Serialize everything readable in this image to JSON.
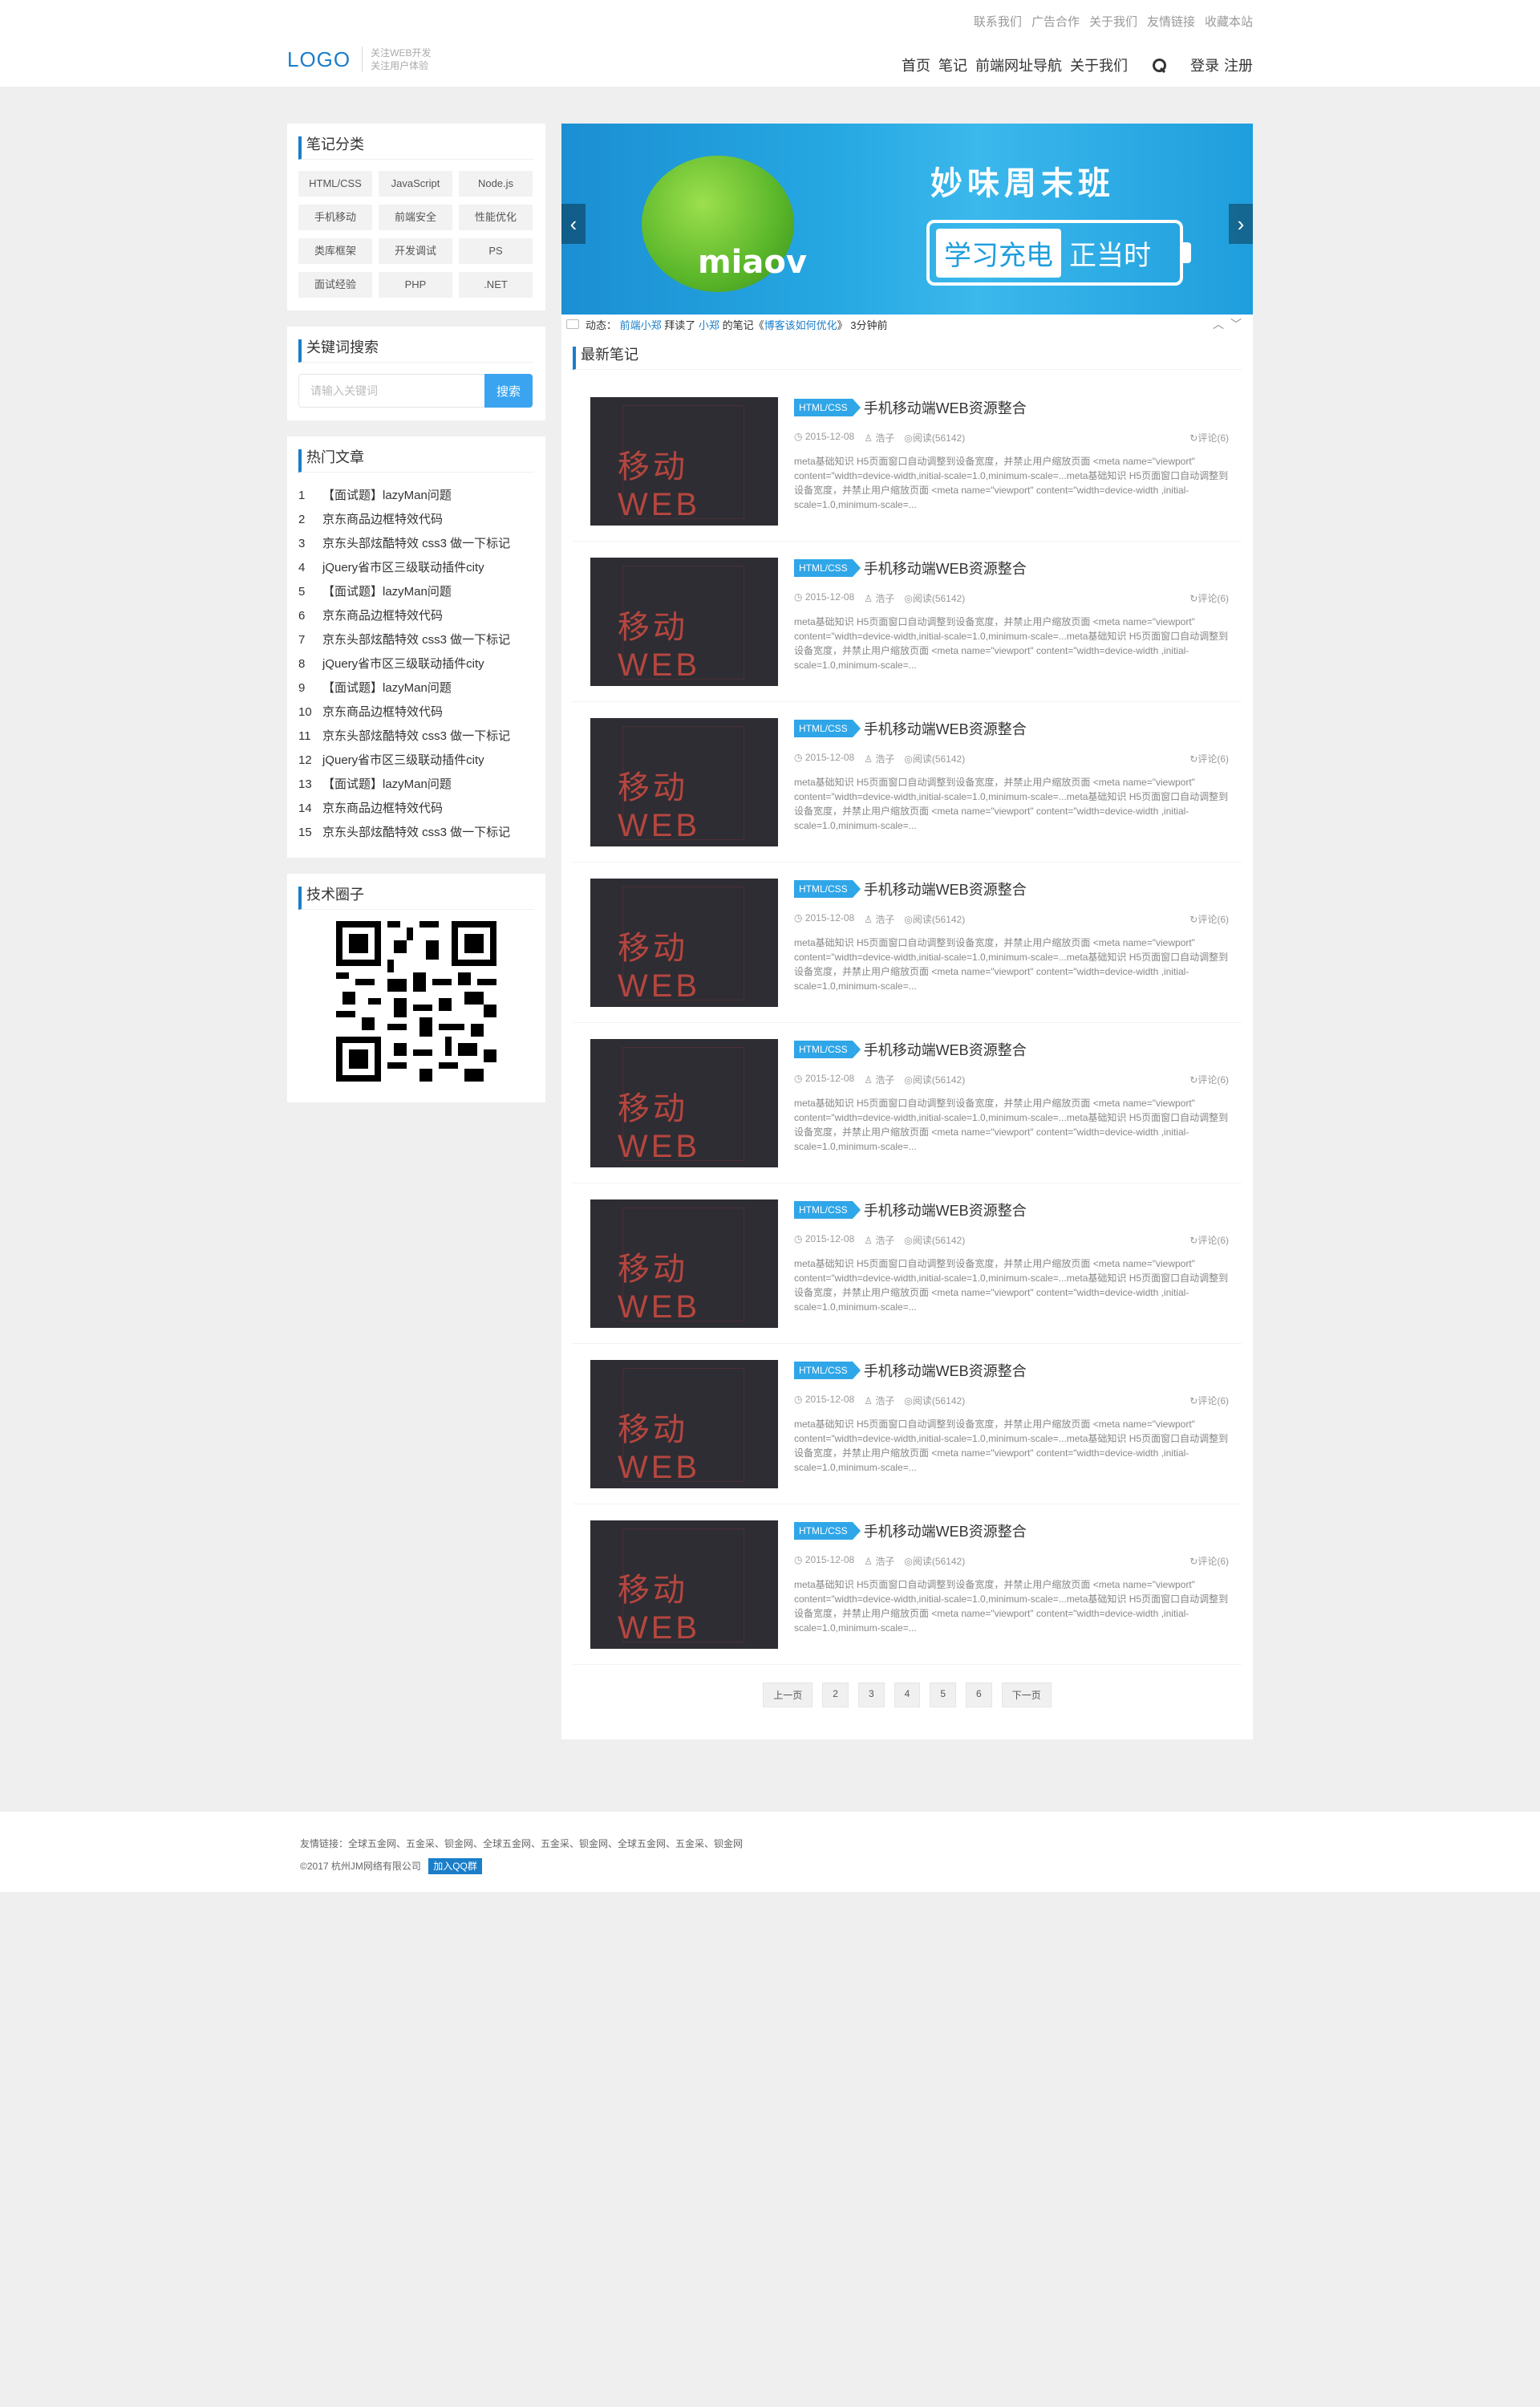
{
  "header": {
    "top_links": [
      "联系我们",
      "广告合作",
      "关于我们",
      "友情链接",
      "收藏本站"
    ],
    "logo": "LOGO",
    "slogan": [
      "关注WEB开发",
      "关注用户体验"
    ],
    "nav": [
      "首页",
      "笔记",
      "前端网址导航",
      "关于我们"
    ],
    "login": "登录",
    "register": "注册"
  },
  "sidebar": {
    "categories_title": "笔记分类",
    "categories": [
      "HTML/CSS",
      "JavaScript",
      "Node.js",
      "手机移动",
      "前端安全",
      "性能优化",
      "类库框架",
      "开发调试",
      "PS",
      "面试经验",
      "PHP",
      ".NET"
    ],
    "search_title": "关键词搜索",
    "search_placeholder": "请输入关键词",
    "search_button": "搜索",
    "hot_title": "热门文章",
    "hot_articles": [
      "【面试题】lazyMan问题",
      "京东商品边框特效代码",
      "京东头部炫酷特效 css3 做一下标记",
      "jQuery省市区三级联动插件city",
      "【面试题】lazyMan问题",
      "京东商品边框特效代码",
      "京东头部炫酷特效 css3 做一下标记",
      "jQuery省市区三级联动插件city",
      "【面试题】lazyMan问题",
      "京东商品边框特效代码",
      "京东头部炫酷特效 css3 做一下标记",
      "jQuery省市区三级联动插件city",
      "【面试题】lazyMan问题",
      "京东商品边框特效代码",
      "京东头部炫酷特效 css3 做一下标记"
    ],
    "circle_title": "技术圈子"
  },
  "banner": {
    "brand": "miaov",
    "title": "妙味周末班",
    "battery_highlight": "学习充电",
    "battery_text": "正当时",
    "prev": "‹",
    "next": "›"
  },
  "ticker": {
    "label": "动态：",
    "user": "前端小郑",
    "action": "拜读了",
    "author": "小郑",
    "mid": "的笔记《",
    "note": "博客该如何优化",
    "end": "》",
    "time": "3分钟前",
    "up": "︿",
    "down": "﹀"
  },
  "notes_section": {
    "title": "最新笔记",
    "thumb_text": "移动 WEB",
    "items": [
      {
        "tag": "HTML/CSS",
        "title": "手机移动端WEB资源整合",
        "date": "2015-12-08",
        "author": "浩子",
        "views": "阅读(56142)",
        "comments": "评论(6)",
        "excerpt": "meta基础知识 H5页面窗口自动调整到设备宽度，并禁止用户缩放页面 <meta name=\"viewport\" content=\"width=device-width,initial-scale=1.0,minimum-scale=...meta基础知识 H5页面窗口自动调整到设备宽度，并禁止用户缩放页面 <meta name=\"viewport\" content=\"width=device-width ,initial-scale=1.0,minimum-scale=..."
      },
      {
        "tag": "HTML/CSS",
        "title": "手机移动端WEB资源整合",
        "date": "2015-12-08",
        "author": "浩子",
        "views": "阅读(56142)",
        "comments": "评论(6)",
        "excerpt": "meta基础知识 H5页面窗口自动调整到设备宽度，并禁止用户缩放页面 <meta name=\"viewport\" content=\"width=device-width,initial-scale=1.0,minimum-scale=...meta基础知识 H5页面窗口自动调整到设备宽度，并禁止用户缩放页面 <meta name=\"viewport\" content=\"width=device-width ,initial-scale=1.0,minimum-scale=..."
      },
      {
        "tag": "HTML/CSS",
        "title": "手机移动端WEB资源整合",
        "date": "2015-12-08",
        "author": "浩子",
        "views": "阅读(56142)",
        "comments": "评论(6)",
        "excerpt": "meta基础知识 H5页面窗口自动调整到设备宽度，并禁止用户缩放页面 <meta name=\"viewport\" content=\"width=device-width,initial-scale=1.0,minimum-scale=...meta基础知识 H5页面窗口自动调整到设备宽度，并禁止用户缩放页面 <meta name=\"viewport\" content=\"width=device-width ,initial-scale=1.0,minimum-scale=..."
      },
      {
        "tag": "HTML/CSS",
        "title": "手机移动端WEB资源整合",
        "date": "2015-12-08",
        "author": "浩子",
        "views": "阅读(56142)",
        "comments": "评论(6)",
        "excerpt": "meta基础知识 H5页面窗口自动调整到设备宽度，并禁止用户缩放页面 <meta name=\"viewport\" content=\"width=device-width,initial-scale=1.0,minimum-scale=...meta基础知识 H5页面窗口自动调整到设备宽度，并禁止用户缩放页面 <meta name=\"viewport\" content=\"width=device-width ,initial-scale=1.0,minimum-scale=..."
      },
      {
        "tag": "HTML/CSS",
        "title": "手机移动端WEB资源整合",
        "date": "2015-12-08",
        "author": "浩子",
        "views": "阅读(56142)",
        "comments": "评论(6)",
        "excerpt": "meta基础知识 H5页面窗口自动调整到设备宽度，并禁止用户缩放页面 <meta name=\"viewport\" content=\"width=device-width,initial-scale=1.0,minimum-scale=...meta基础知识 H5页面窗口自动调整到设备宽度，并禁止用户缩放页面 <meta name=\"viewport\" content=\"width=device-width ,initial-scale=1.0,minimum-scale=..."
      },
      {
        "tag": "HTML/CSS",
        "title": "手机移动端WEB资源整合",
        "date": "2015-12-08",
        "author": "浩子",
        "views": "阅读(56142)",
        "comments": "评论(6)",
        "excerpt": "meta基础知识 H5页面窗口自动调整到设备宽度，并禁止用户缩放页面 <meta name=\"viewport\" content=\"width=device-width,initial-scale=1.0,minimum-scale=...meta基础知识 H5页面窗口自动调整到设备宽度，并禁止用户缩放页面 <meta name=\"viewport\" content=\"width=device-width ,initial-scale=1.0,minimum-scale=..."
      },
      {
        "tag": "HTML/CSS",
        "title": "手机移动端WEB资源整合",
        "date": "2015-12-08",
        "author": "浩子",
        "views": "阅读(56142)",
        "comments": "评论(6)",
        "excerpt": "meta基础知识 H5页面窗口自动调整到设备宽度，并禁止用户缩放页面 <meta name=\"viewport\" content=\"width=device-width,initial-scale=1.0,minimum-scale=...meta基础知识 H5页面窗口自动调整到设备宽度，并禁止用户缩放页面 <meta name=\"viewport\" content=\"width=device-width ,initial-scale=1.0,minimum-scale=..."
      },
      {
        "tag": "HTML/CSS",
        "title": "手机移动端WEB资源整合",
        "date": "2015-12-08",
        "author": "浩子",
        "views": "阅读(56142)",
        "comments": "评论(6)",
        "excerpt": "meta基础知识 H5页面窗口自动调整到设备宽度，并禁止用户缩放页面 <meta name=\"viewport\" content=\"width=device-width,initial-scale=1.0,minimum-scale=...meta基础知识 H5页面窗口自动调整到设备宽度，并禁止用户缩放页面 <meta name=\"viewport\" content=\"width=device-width ,initial-scale=1.0,minimum-scale=..."
      }
    ],
    "pager": [
      "上一页",
      "2",
      "3",
      "4",
      "5",
      "6",
      "下一页"
    ]
  },
  "footer": {
    "links": "友情链接：全球五金网、五金采、钡金网、全球五金网、五金采、钡金网、全球五金网、五金采、钡金网",
    "copyright": "©2017 杭州JM网络有限公司",
    "qq": "加入QQ群"
  },
  "colors": {
    "accent": "#1a7ec9",
    "button": "#3aa4f0",
    "tag": "#2fa6e8"
  }
}
